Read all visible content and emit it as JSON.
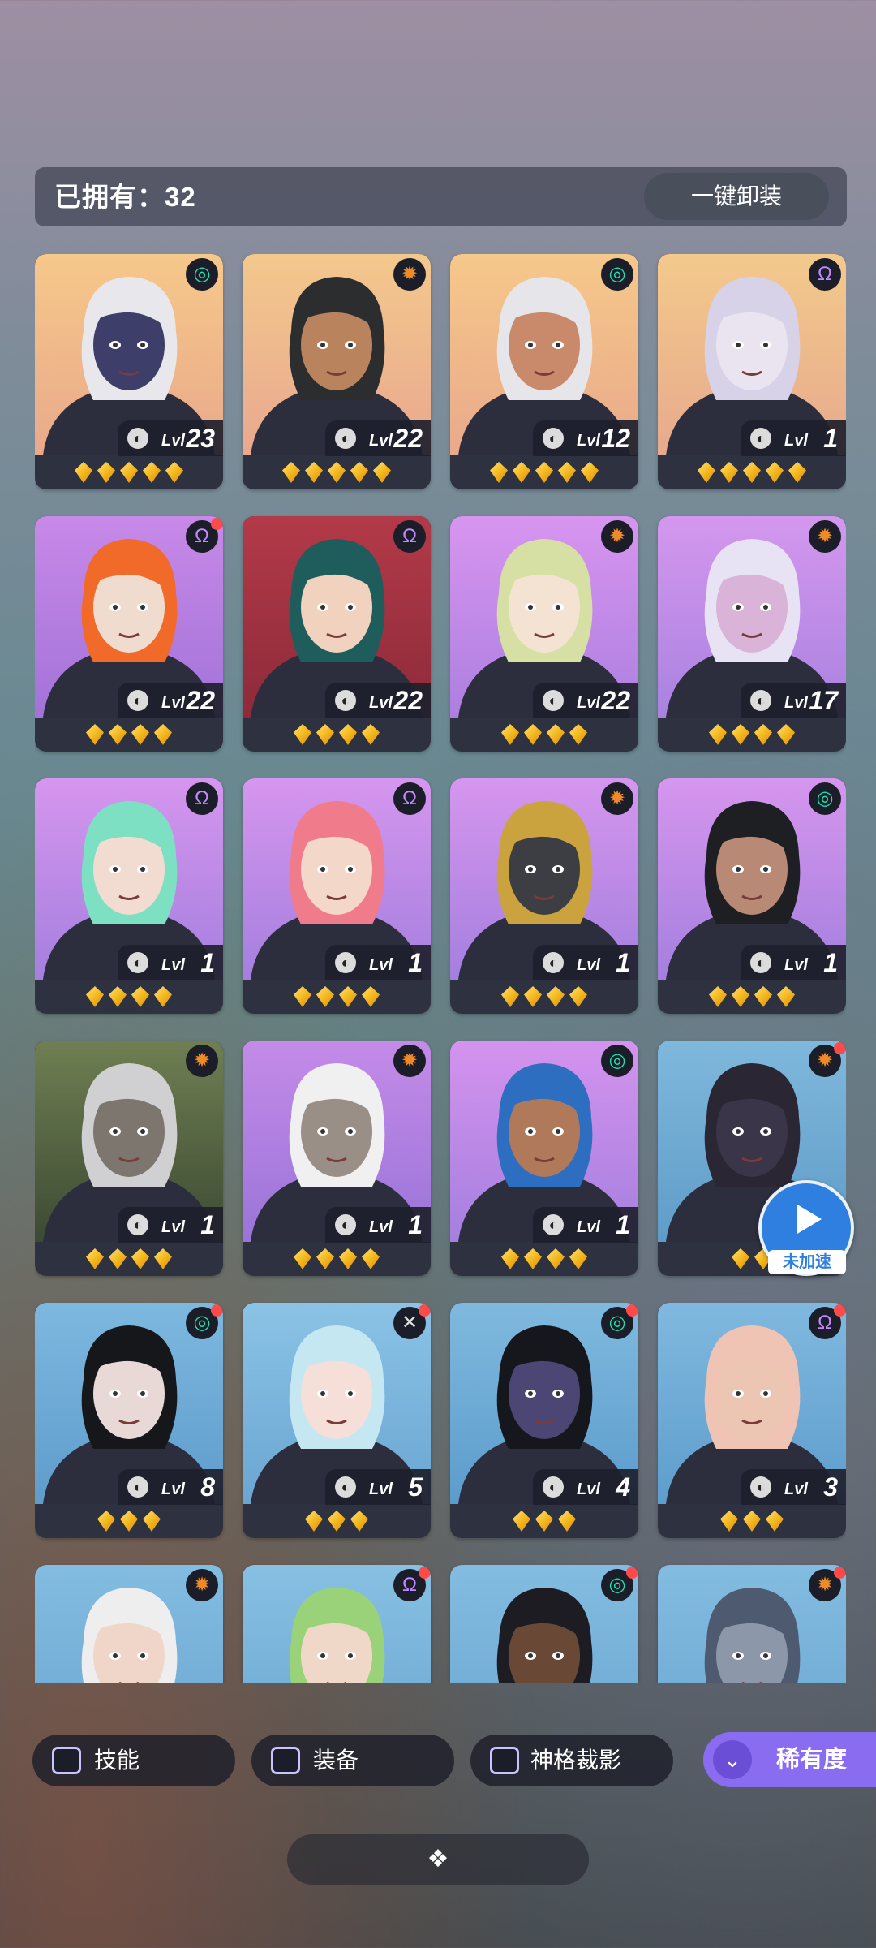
{
  "header": {
    "owned_label": "已拥有：32",
    "unequip_label": "一键卸装"
  },
  "cards": [
    {
      "level": "23",
      "stars": 5,
      "badge": "green",
      "badge_icon": "swirl-icon",
      "red_dot": false,
      "hair": "#e8e8ec",
      "skin": "#3d3f6a",
      "bg1": "#f6c88a",
      "bg2": "#e9a98b"
    },
    {
      "level": "22",
      "stars": 5,
      "badge": "orange",
      "badge_icon": "sun-icon",
      "red_dot": false,
      "hair": "#2b2d2f",
      "skin": "#b9835d",
      "bg1": "#f3c88c",
      "bg2": "#e9a88f"
    },
    {
      "level": "12",
      "stars": 5,
      "badge": "green",
      "badge_icon": "swirl-icon",
      "red_dot": false,
      "hair": "#e6e6ea",
      "skin": "#c98a6c",
      "bg1": "#f6c88a",
      "bg2": "#e9a98b"
    },
    {
      "level": "1",
      "stars": 5,
      "badge": "purple",
      "badge_icon": "helix-icon",
      "red_dot": false,
      "hair": "#d8d2e8",
      "skin": "#e9e4ef",
      "bg1": "#f3c98c",
      "bg2": "#e7aa8d"
    },
    {
      "level": "22",
      "stars": 4,
      "badge": "purple",
      "badge_icon": "helix-icon",
      "red_dot": true,
      "hair": "#f16a2a",
      "skin": "#f0dccf",
      "bg1": "#c889e8",
      "bg2": "#a273d8"
    },
    {
      "level": "22",
      "stars": 4,
      "badge": "purple",
      "badge_icon": "helix-icon",
      "red_dot": false,
      "hair": "#1e5d5c",
      "skin": "#f0d2bf",
      "bg1": "#b33a48",
      "bg2": "#8d2a3a"
    },
    {
      "level": "22",
      "stars": 4,
      "badge": "orange",
      "badge_icon": "sun-icon",
      "red_dot": false,
      "hair": "#d7e0a4",
      "skin": "#f4e3d2",
      "bg1": "#d795ef",
      "bg2": "#ad7fe0"
    },
    {
      "level": "17",
      "stars": 4,
      "badge": "orange",
      "badge_icon": "sun-icon",
      "red_dot": false,
      "hair": "#e8e3f4",
      "skin": "#d9b3d8",
      "bg1": "#d497ee",
      "bg2": "#a982e0"
    },
    {
      "level": "1",
      "stars": 4,
      "badge": "purple",
      "badge_icon": "helix-icon",
      "red_dot": false,
      "hair": "#7ee0c2",
      "skin": "#f2dcd2",
      "bg1": "#d596ee",
      "bg2": "#a57fdf"
    },
    {
      "level": "1",
      "stars": 4,
      "badge": "purple",
      "badge_icon": "helix-icon",
      "red_dot": false,
      "hair": "#f07b8a",
      "skin": "#f3d7c8",
      "bg1": "#d596ee",
      "bg2": "#a57fdf"
    },
    {
      "level": "1",
      "stars": 4,
      "badge": "orange",
      "badge_icon": "sun-icon",
      "red_dot": false,
      "hair": "#caa33e",
      "skin": "#3c3e44",
      "bg1": "#d596ee",
      "bg2": "#a57fdf"
    },
    {
      "level": "1",
      "stars": 4,
      "badge": "green",
      "badge_icon": "swirl-icon",
      "red_dot": false,
      "hair": "#1e1f22",
      "skin": "#b88a76",
      "bg1": "#d596ee",
      "bg2": "#a57fdf"
    },
    {
      "level": "1",
      "stars": 4,
      "badge": "orange",
      "badge_icon": "sun-icon",
      "red_dot": false,
      "hair": "#d0d0d2",
      "skin": "#7c766f",
      "bg1": "#6f7f52",
      "bg2": "#3d4a33"
    },
    {
      "level": "1",
      "stars": 4,
      "badge": "orange",
      "badge_icon": "sun-icon",
      "red_dot": false,
      "hair": "#f0f0f0",
      "skin": "#9a8f87",
      "bg1": "#c48be8",
      "bg2": "#9a74d8"
    },
    {
      "level": "1",
      "stars": 4,
      "badge": "green",
      "badge_icon": "swirl-icon",
      "red_dot": false,
      "hair": "#2d6ec0",
      "skin": "#b07a5a",
      "bg1": "#d493ee",
      "bg2": "#a57fdf"
    },
    {
      "level": "",
      "stars": 2,
      "badge": "orange",
      "badge_icon": "sun-icon",
      "red_dot": true,
      "hair": "#2a2633",
      "skin": "#3a3548",
      "bg1": "#7fb8dc",
      "bg2": "#5f9cc8"
    },
    {
      "level": "8",
      "stars": 3,
      "badge": "green",
      "badge_icon": "swirl-icon",
      "red_dot": true,
      "hair": "#16171b",
      "skin": "#e8d8d6",
      "bg1": "#7db8df",
      "bg2": "#5f9ccc"
    },
    {
      "level": "5",
      "stars": 3,
      "badge": "gray",
      "badge_icon": "cross-icon",
      "red_dot": true,
      "hair": "#c5e7f2",
      "skin": "#f5dfd8",
      "bg1": "#8bc3e6",
      "bg2": "#6aa6d2"
    },
    {
      "level": "4",
      "stars": 3,
      "badge": "green",
      "badge_icon": "swirl-icon",
      "red_dot": true,
      "hair": "#15171d",
      "skin": "#4b4673",
      "bg1": "#7fb9de",
      "bg2": "#5c9ccc"
    },
    {
      "level": "3",
      "stars": 3,
      "badge": "purple",
      "badge_icon": "helix-icon",
      "red_dot": true,
      "hair": "#f0c4b5",
      "skin": "#ecc6b3",
      "bg1": "#80b9df",
      "bg2": "#5e9dcc"
    },
    {
      "level": "",
      "stars": 0,
      "badge": "orange",
      "badge_icon": "sun-icon",
      "red_dot": false,
      "hair": "#eeeeee",
      "skin": "#f0d6c8",
      "bg1": "#83bce0",
      "bg2": "#6aa6d2"
    },
    {
      "level": "",
      "stars": 0,
      "badge": "purple",
      "badge_icon": "helix-icon",
      "red_dot": true,
      "hair": "#9ad27a",
      "skin": "#f0d8c8",
      "bg1": "#87c0e2",
      "bg2": "#6aa6d2"
    },
    {
      "level": "",
      "stars": 0,
      "badge": "green",
      "badge_icon": "swirl-icon",
      "red_dot": true,
      "hair": "#1c1c22",
      "skin": "#6a4836",
      "bg1": "#83bce0",
      "bg2": "#6aa6d2"
    },
    {
      "level": "",
      "stars": 0,
      "badge": "orange",
      "badge_icon": "sun-icon",
      "red_dot": true,
      "hair": "#4d5a70",
      "skin": "#8c97aa",
      "bg1": "#83bce0",
      "bg2": "#6aa6d2"
    }
  ],
  "level_prefix": "Lvl",
  "speed_button": {
    "label": "未加速"
  },
  "filters": [
    {
      "label": "技能"
    },
    {
      "label": "装备"
    },
    {
      "label": "神格裁影"
    }
  ],
  "rarity": {
    "label": "稀有度"
  },
  "badge_glyphs": {
    "swirl-icon": "◎",
    "sun-icon": "✹",
    "helix-icon": "Ω",
    "cross-icon": "✕"
  }
}
